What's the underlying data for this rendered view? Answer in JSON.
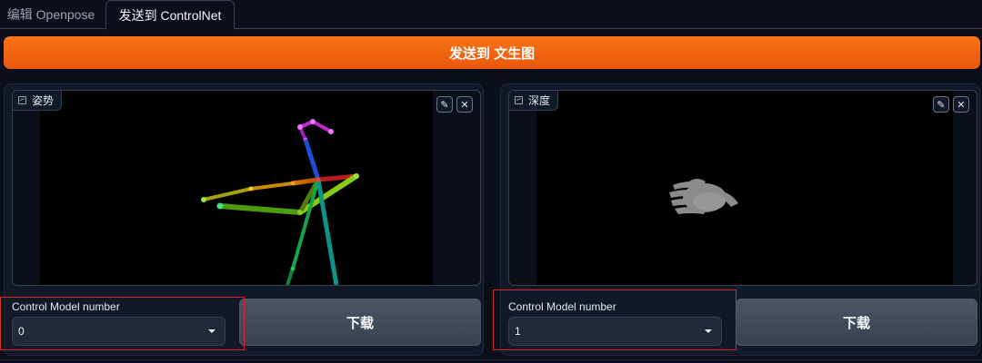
{
  "tabs": [
    {
      "label": "编辑 Openpose",
      "active": false
    },
    {
      "label": "发送到 ControlNet",
      "active": true
    }
  ],
  "send_button": {
    "label": "发送到 文生图"
  },
  "panels": [
    {
      "image_label": "姿势",
      "image_icon": "image-icon",
      "actions": [
        "edit-icon",
        "close-icon"
      ],
      "control_model_label": "Control Model number",
      "control_model_value": "0",
      "download_label": "下载"
    },
    {
      "image_label": "深度",
      "image_icon": "image-icon",
      "actions": [
        "edit-icon",
        "close-icon"
      ],
      "control_model_label": "Control Model number",
      "control_model_value": "1",
      "download_label": "下载"
    }
  ],
  "colors": {
    "accent": "#f97316",
    "highlight": "#dc2626",
    "background": "#0b0f19"
  }
}
